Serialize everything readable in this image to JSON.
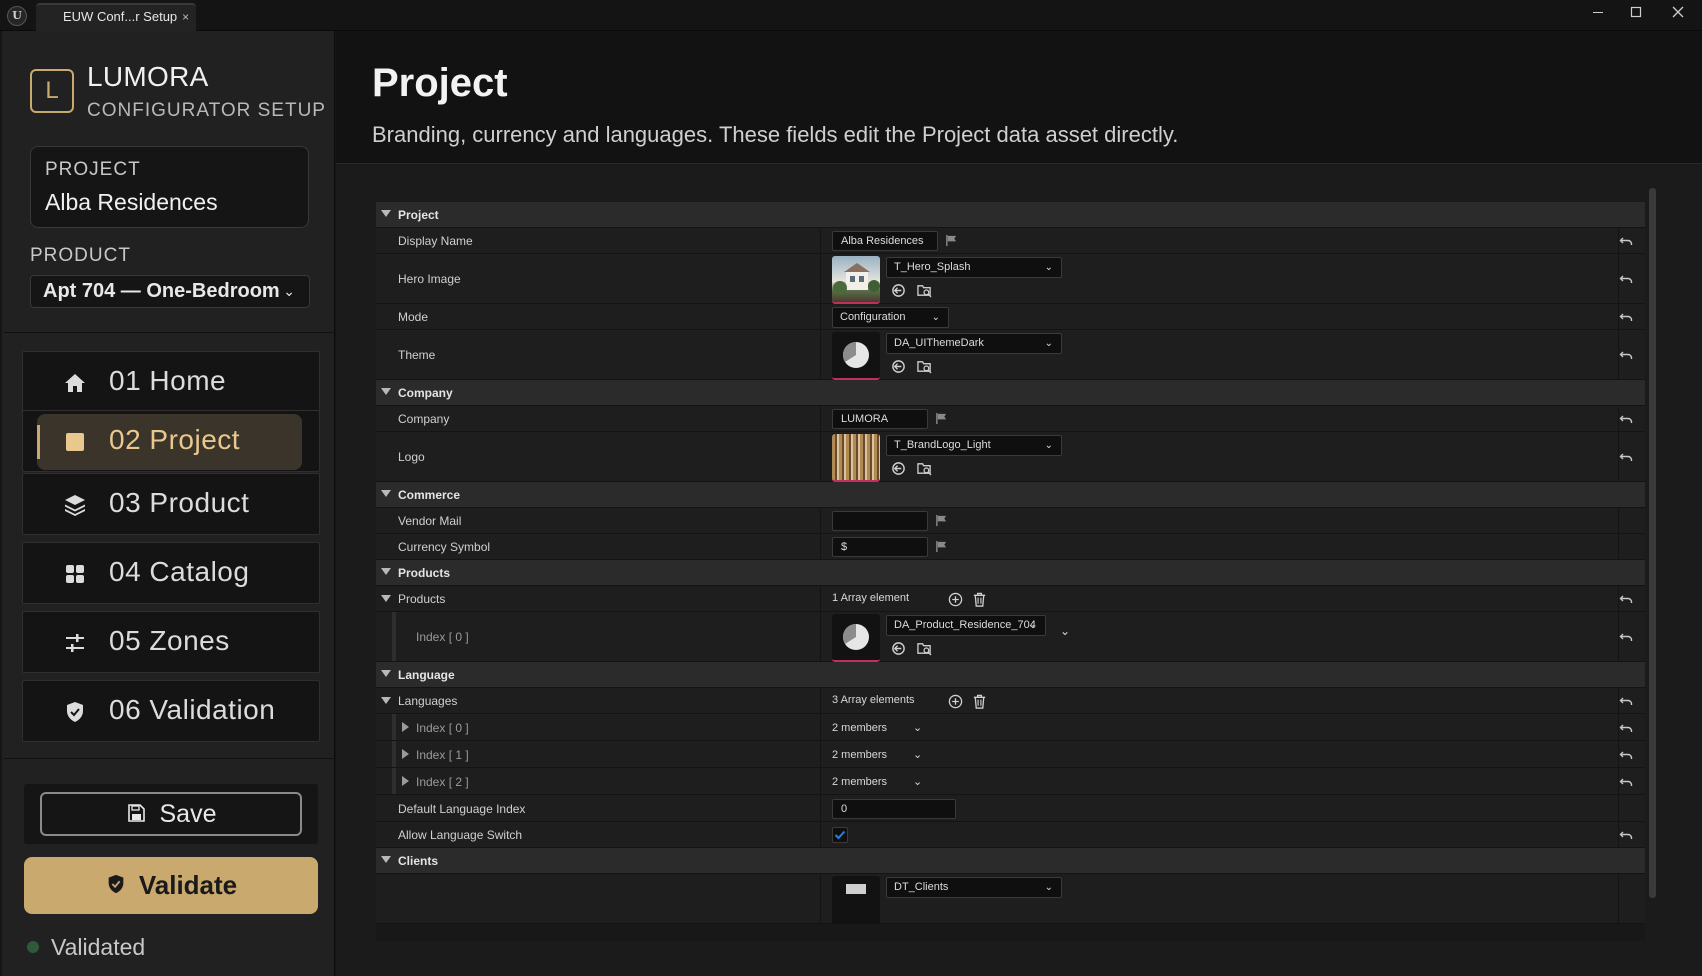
{
  "window": {
    "tab_title": "EUW Conf...r Setup",
    "tab_close": "×",
    "logo_text": "U"
  },
  "sidebar": {
    "brand_letter": "L",
    "brand_name": "LUMORA",
    "brand_subtitle": "CONFIGURATOR SETUP",
    "project_label": "PROJECT",
    "project_value": "Alba Residences",
    "product_label": "PRODUCT",
    "product_value": "Apt 704 — One-Bedroom",
    "nav": [
      {
        "label": "01  Home",
        "icon": "home-icon"
      },
      {
        "label": "02  Project",
        "icon": "list-icon",
        "active": true
      },
      {
        "label": "03  Product",
        "icon": "layers-icon"
      },
      {
        "label": "04  Catalog",
        "icon": "grid-icon"
      },
      {
        "label": "05  Zones",
        "icon": "sliders-icon"
      },
      {
        "label": "06  Validation",
        "icon": "shield-check-icon"
      }
    ],
    "save_label": "Save",
    "validate_label": "Validate",
    "status_text": "Validated",
    "accent_color": "#c9a96e",
    "status_color": "#2e5a3a"
  },
  "header": {
    "title": "Project",
    "subtitle": "Branding, currency and languages. These fields edit the Project data asset directly."
  },
  "details": {
    "cat_project": "Project",
    "display_name_label": "Display Name",
    "display_name_value": "Alba Residences",
    "hero_image_label": "Hero Image",
    "hero_image_value": "T_Hero_Splash",
    "mode_label": "Mode",
    "mode_value": "Configuration",
    "theme_label": "Theme",
    "theme_value": "DA_UIThemeDark",
    "cat_company": "Company",
    "company_label": "Company",
    "company_value": "LUMORA",
    "logo_label": "Logo",
    "logo_value": "T_BrandLogo_Light",
    "cat_commerce": "Commerce",
    "vendor_mail_label": "Vendor Mail",
    "vendor_mail_value": "",
    "currency_symbol_label": "Currency Symbol",
    "currency_symbol_value": "$",
    "cat_products": "Products",
    "products_label": "Products",
    "products_count": "1 Array element",
    "products_index0_label": "Index [ 0 ]",
    "products_index0_value": "DA_Product_Residence_704",
    "cat_language": "Language",
    "languages_label": "Languages",
    "languages_count": "3 Array elements",
    "lang_index0_label": "Index [ 0 ]",
    "lang_index0_value": "2 members",
    "lang_index1_label": "Index [ 1 ]",
    "lang_index1_value": "2 members",
    "lang_index2_label": "Index [ 2 ]",
    "lang_index2_value": "2 members",
    "default_lang_label": "Default Language Index",
    "default_lang_value": "0",
    "allow_switch_label": "Allow Language Switch",
    "allow_switch_checked": true,
    "cat_clients": "Clients",
    "clients_value": "DT_Clients"
  }
}
